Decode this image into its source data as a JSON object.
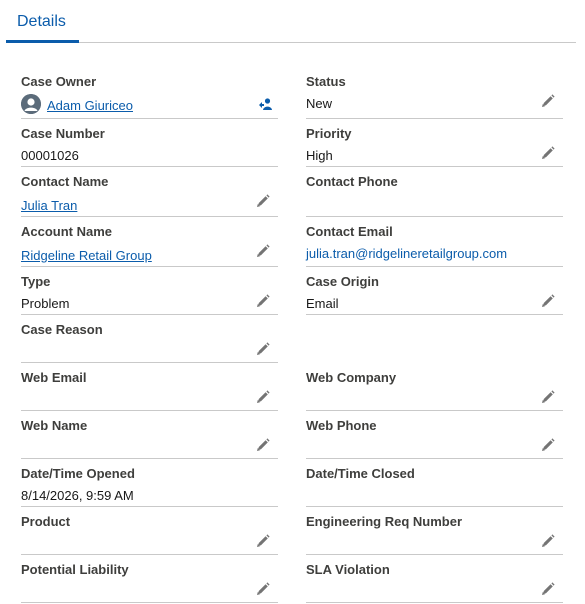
{
  "tabs": [
    {
      "label": "Details"
    }
  ],
  "fields": {
    "case_owner": {
      "label": "Case Owner",
      "value": "Adam Giuriceo"
    },
    "status": {
      "label": "Status",
      "value": "New"
    },
    "case_number": {
      "label": "Case Number",
      "value": "00001026"
    },
    "priority": {
      "label": "Priority",
      "value": "High"
    },
    "contact_name": {
      "label": "Contact Name",
      "value": "Julia Tran"
    },
    "contact_phone": {
      "label": "Contact Phone",
      "value": ""
    },
    "account_name": {
      "label": "Account Name",
      "value": "Ridgeline Retail Group"
    },
    "contact_email": {
      "label": "Contact Email",
      "value": "julia.tran@ridgelineretailgroup.com"
    },
    "type": {
      "label": "Type",
      "value": "Problem"
    },
    "case_origin": {
      "label": "Case Origin",
      "value": "Email"
    },
    "case_reason": {
      "label": "Case Reason",
      "value": ""
    },
    "web_email": {
      "label": "Web Email",
      "value": ""
    },
    "web_company": {
      "label": "Web Company",
      "value": ""
    },
    "web_name": {
      "label": "Web Name",
      "value": ""
    },
    "web_phone": {
      "label": "Web Phone",
      "value": ""
    },
    "date_opened": {
      "label": "Date/Time Opened",
      "value": "8/14/2026, 9:59 AM"
    },
    "date_closed": {
      "label": "Date/Time Closed",
      "value": ""
    },
    "product": {
      "label": "Product",
      "value": ""
    },
    "engineering_req_number": {
      "label": "Engineering Req Number",
      "value": ""
    },
    "potential_liability": {
      "label": "Potential Liability",
      "value": ""
    },
    "sla_violation": {
      "label": "SLA Violation",
      "value": ""
    }
  },
  "icons": {
    "edit": "pencil-icon",
    "change_owner": "change-owner-icon",
    "avatar": "user-avatar"
  },
  "colors": {
    "accent": "#0b5cab",
    "divider": "#c9c9c9",
    "icon": "#747474"
  }
}
